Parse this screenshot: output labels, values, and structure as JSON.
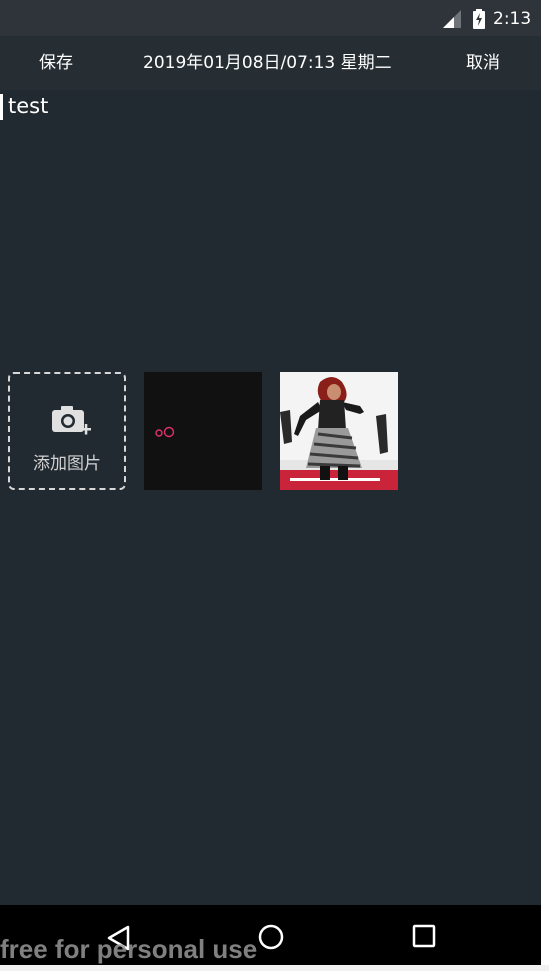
{
  "status_bar": {
    "time": "2:13",
    "icons": [
      "signal-icon",
      "battery-icon"
    ]
  },
  "action_bar": {
    "save_label": "保存",
    "datetime": "2019年01月08日/07:13 星期二",
    "cancel_label": "取消"
  },
  "note": {
    "text": "test"
  },
  "images": {
    "add_label": "添加图片",
    "add_icon": "camera-plus-icon"
  },
  "nav_bar": {
    "icons": [
      "back-icon",
      "home-icon",
      "recents-icon"
    ]
  },
  "watermark": {
    "text": "free for personal use"
  },
  "colors": {
    "background": "#222a31",
    "status_bar": "#2e3439",
    "nav_bar": "#000000"
  }
}
